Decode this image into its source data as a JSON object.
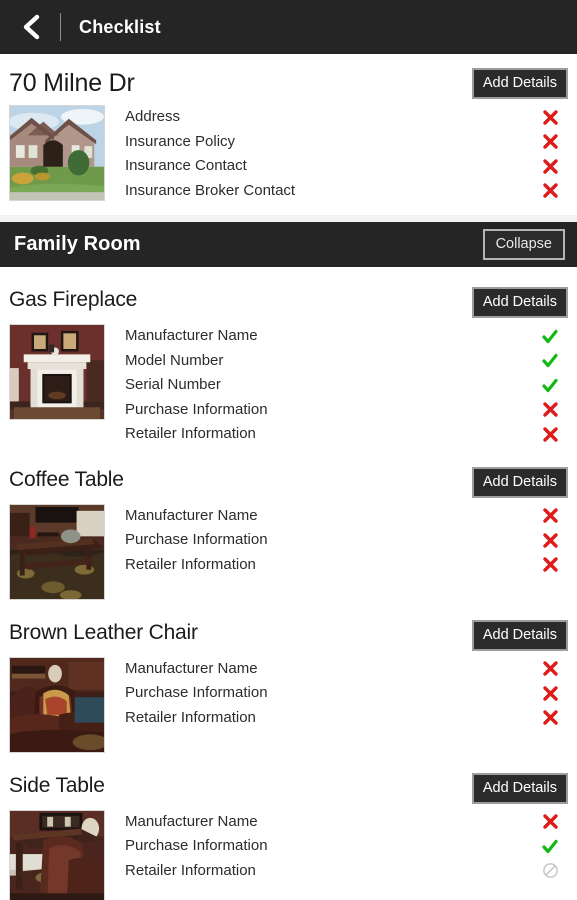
{
  "appbar": {
    "back_icon": "chevron-left-icon",
    "title": "Checklist"
  },
  "property": {
    "title": "70 Milne Dr",
    "add_details_label": "Add Details",
    "thumbnail": "house-exterior-photo",
    "fields": [
      {
        "label": "Address",
        "status": "missing"
      },
      {
        "label": "Insurance Policy",
        "status": "missing"
      },
      {
        "label": "Insurance Contact",
        "status": "missing"
      },
      {
        "label": "Insurance Broker Contact",
        "status": "missing"
      }
    ]
  },
  "room": {
    "title": "Family Room",
    "collapse_label": "Collapse",
    "items": [
      {
        "title": "Gas Fireplace",
        "add_details_label": "Add Details",
        "thumbnail": "fireplace-photo",
        "fields": [
          {
            "label": "Manufacturer Name",
            "status": "complete"
          },
          {
            "label": "Model Number",
            "status": "complete"
          },
          {
            "label": "Serial Number",
            "status": "complete"
          },
          {
            "label": "Purchase Information",
            "status": "missing"
          },
          {
            "label": "Retailer Information",
            "status": "missing"
          }
        ]
      },
      {
        "title": "Coffee Table",
        "add_details_label": "Add Details",
        "thumbnail": "coffee-table-photo",
        "fields": [
          {
            "label": "Manufacturer Name",
            "status": "missing"
          },
          {
            "label": "Purchase Information",
            "status": "missing"
          },
          {
            "label": "Retailer Information",
            "status": "missing"
          }
        ]
      },
      {
        "title": "Brown Leather Chair",
        "add_details_label": "Add Details",
        "thumbnail": "leather-chair-photo",
        "fields": [
          {
            "label": "Manufacturer Name",
            "status": "missing"
          },
          {
            "label": "Purchase Information",
            "status": "missing"
          },
          {
            "label": "Retailer Information",
            "status": "missing"
          }
        ]
      },
      {
        "title": "Side Table",
        "add_details_label": "Add Details",
        "thumbnail": "side-table-photo",
        "fields": [
          {
            "label": "Manufacturer Name",
            "status": "missing"
          },
          {
            "label": "Purchase Information",
            "status": "complete"
          },
          {
            "label": "Retailer Information",
            "status": "not-applicable"
          }
        ]
      }
    ]
  },
  "status_icons": {
    "missing": "red-x-icon",
    "complete": "green-check-icon",
    "not-applicable": "grey-prohibited-icon"
  },
  "colors": {
    "missing": "#e01b1b",
    "complete": "#14b814",
    "not_applicable": "#c8c8c8",
    "bar_background": "#252525",
    "button_background": "#2b2b2b"
  }
}
